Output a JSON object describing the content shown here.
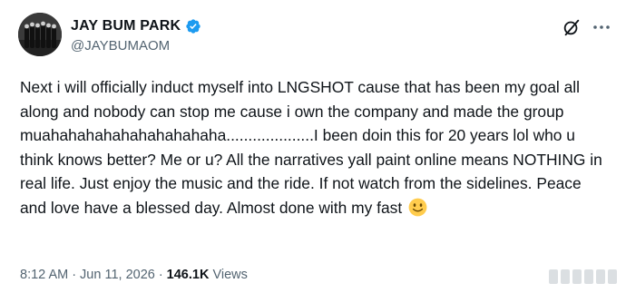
{
  "author": {
    "display_name": "JAY BUM PARK",
    "handle": "@JAYBUMAOM",
    "verified": true,
    "avatar_icon": "group-photo-avatar"
  },
  "toolbar": {
    "grok_icon": "grok-slash-icon",
    "more_icon": "more-dots-icon"
  },
  "tweet": {
    "text": "Next i will officially induct myself into LNGSHOT cause that has been my goal all along and nobody can stop me cause i own the company and made the group muahahahahahahahahahaha....................I been doin this for 20 years lol who u think knows better? Me or u? All the narratives yall paint online means NOTHING in real life. Just enjoy the music and the ride. If not watch from the sidelines. Peace and love have a blessed day. Almost done with my fast",
    "emoji": "slightly-smiling-face"
  },
  "meta": {
    "time": "8:12 AM",
    "separator": "·",
    "date": "Jun 11, 2026",
    "views_count": "146.1K",
    "views_label": "Views"
  },
  "colors": {
    "text": "#0f1419",
    "secondary": "#536471",
    "verified": "#1d9bf0"
  }
}
